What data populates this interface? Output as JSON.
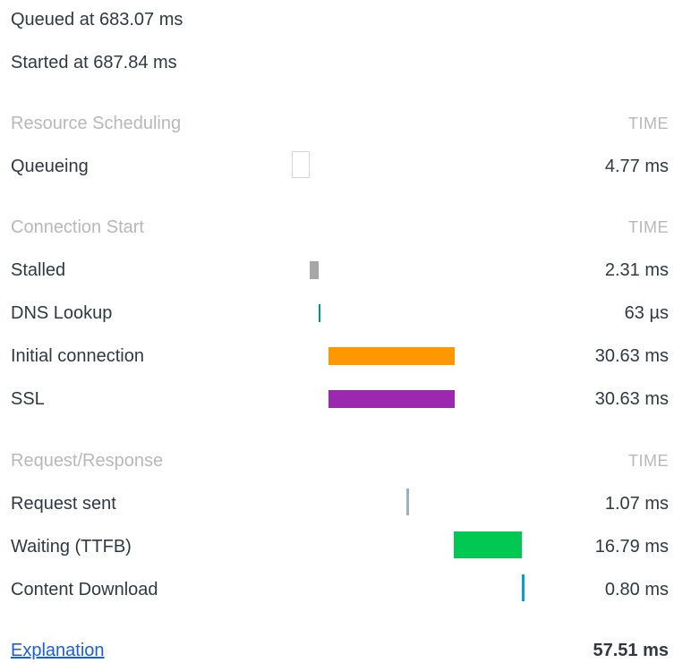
{
  "summary": {
    "queued": "Queued at 683.07 ms",
    "started": "Started at 687.84 ms"
  },
  "sections": {
    "scheduling": {
      "title": "Resource Scheduling",
      "time_header": "TIME"
    },
    "connection": {
      "title": "Connection Start",
      "time_header": "TIME"
    },
    "request": {
      "title": "Request/Response",
      "time_header": "TIME"
    }
  },
  "rows": {
    "queueing": {
      "label": "Queueing",
      "value": "4.77 ms"
    },
    "stalled": {
      "label": "Stalled",
      "value": "2.31 ms"
    },
    "dns": {
      "label": "DNS Lookup",
      "value": "63 µs"
    },
    "initial": {
      "label": "Initial connection",
      "value": "30.63 ms"
    },
    "ssl": {
      "label": "SSL",
      "value": "30.63 ms"
    },
    "sent": {
      "label": "Request sent",
      "value": "1.07 ms"
    },
    "waiting": {
      "label": "Waiting (TTFB)",
      "value": "16.79 ms"
    },
    "download": {
      "label": "Content Download",
      "value": "0.80 ms"
    }
  },
  "footer": {
    "link": "Explanation",
    "total": "57.51 ms"
  },
  "colors": {
    "queueing": "#ffffff",
    "stalled": "#a6a6a6",
    "dns": "#009688",
    "initial": "#ff9800",
    "ssl": "#9c27b0",
    "sent": "#9cb1c0",
    "waiting": "#00c853",
    "download": "#039be5"
  }
}
